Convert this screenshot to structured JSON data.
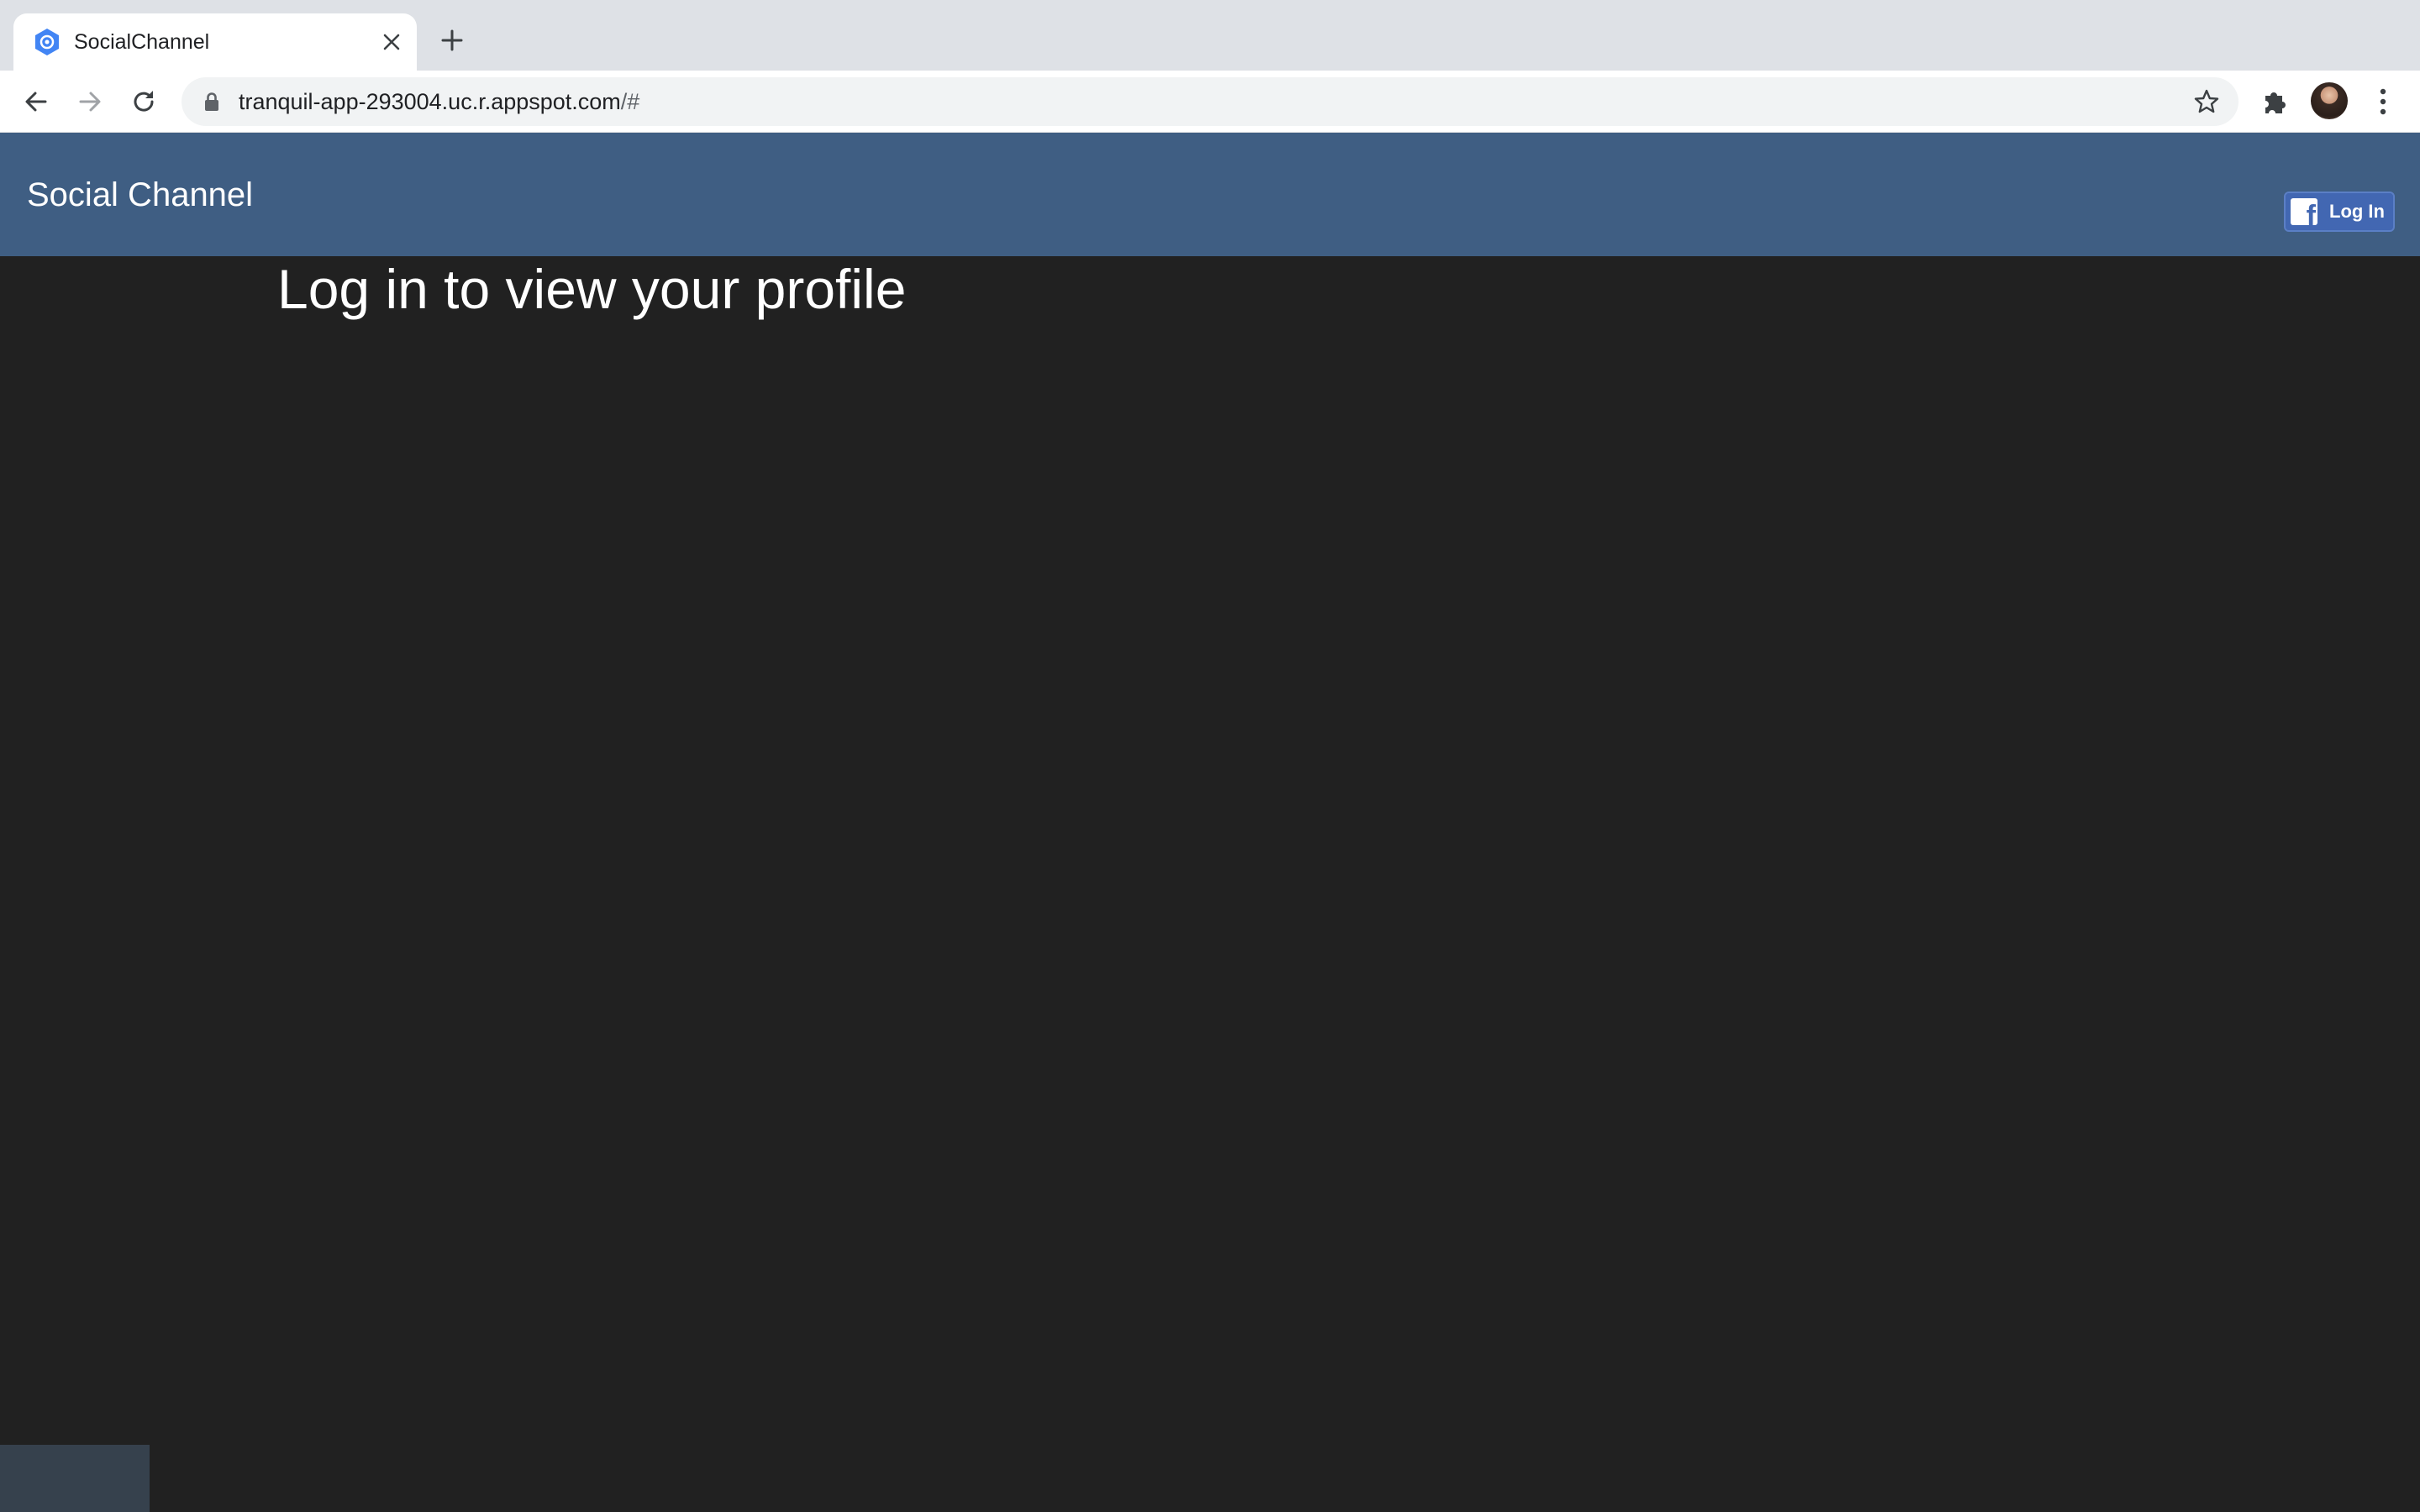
{
  "browser": {
    "tab": {
      "title": "SocialChannel",
      "favicon": "app-engine-icon"
    },
    "url": {
      "host": "tranquil-app-293004.uc.r.appspot.com",
      "path": "/#"
    },
    "icons": {
      "back": "back-arrow-icon",
      "forward": "forward-arrow-icon",
      "reload": "reload-icon",
      "lock": "lock-icon",
      "star": "star-icon",
      "extensions": "puzzle-piece-icon",
      "menu": "kebab-menu-icon"
    }
  },
  "app": {
    "brand": "Social Channel",
    "login_button": "Log In",
    "heading": "Log in to view your profile",
    "colors": {
      "navbar": "#3f5e83",
      "background": "#212121",
      "facebook": "#4267b2"
    }
  }
}
